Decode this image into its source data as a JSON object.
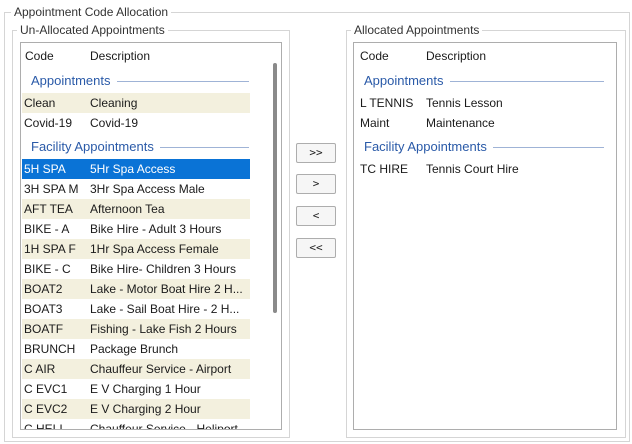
{
  "outer": {
    "title": "Appointment Code Allocation"
  },
  "left": {
    "title": "Un-Allocated Appointments",
    "col_code": "Code",
    "col_desc": "Description",
    "sections": [
      {
        "label": "Appointments",
        "rows": [
          {
            "code": "Clean",
            "desc": "Cleaning"
          },
          {
            "code": "Covid-19",
            "desc": "Covid-19"
          }
        ]
      },
      {
        "label": "Facility Appointments",
        "rows": [
          {
            "code": "5H SPA",
            "desc": "5Hr Spa Access"
          },
          {
            "code": "3H SPA M",
            "desc": "3Hr Spa Access Male"
          },
          {
            "code": "AFT TEA",
            "desc": "Afternoon Tea"
          },
          {
            "code": "BIKE - A",
            "desc": "Bike Hire - Adult 3 Hours"
          },
          {
            "code": "1H SPA F",
            "desc": "1Hr Spa Access Female"
          },
          {
            "code": "BIKE - C",
            "desc": "Bike Hire- Children 3 Hours"
          },
          {
            "code": "BOAT2",
            "desc": "Lake - Motor Boat Hire 2 H..."
          },
          {
            "code": "BOAT3",
            "desc": "Lake - Sail Boat Hire - 2 H..."
          },
          {
            "code": "BOATF",
            "desc": "Fishing - Lake Fish 2 Hours"
          },
          {
            "code": "BRUNCH",
            "desc": "Package Brunch"
          },
          {
            "code": "C AIR",
            "desc": "Chauffeur Service - Airport"
          },
          {
            "code": "C EVC1",
            "desc": "E V Charging 1 Hour"
          },
          {
            "code": "C EVC2",
            "desc": "E V Charging 2 Hour"
          },
          {
            "code": "C HELI",
            "desc": "Chauffeur Service - Heliport"
          }
        ]
      }
    ]
  },
  "buttons": {
    "add_all": ">>",
    "add": ">",
    "remove": "<",
    "remove_all": "<<"
  },
  "right": {
    "title": "Allocated Appointments",
    "col_code": "Code",
    "col_desc": "Description",
    "sections": [
      {
        "label": "Appointments",
        "rows": [
          {
            "code": "L TENNIS",
            "desc": "Tennis Lesson"
          },
          {
            "code": "Maint",
            "desc": "Maintenance"
          }
        ]
      },
      {
        "label": "Facility Appointments",
        "rows": [
          {
            "code": "TC HIRE",
            "desc": "Tennis Court Hire"
          }
        ]
      }
    ]
  }
}
